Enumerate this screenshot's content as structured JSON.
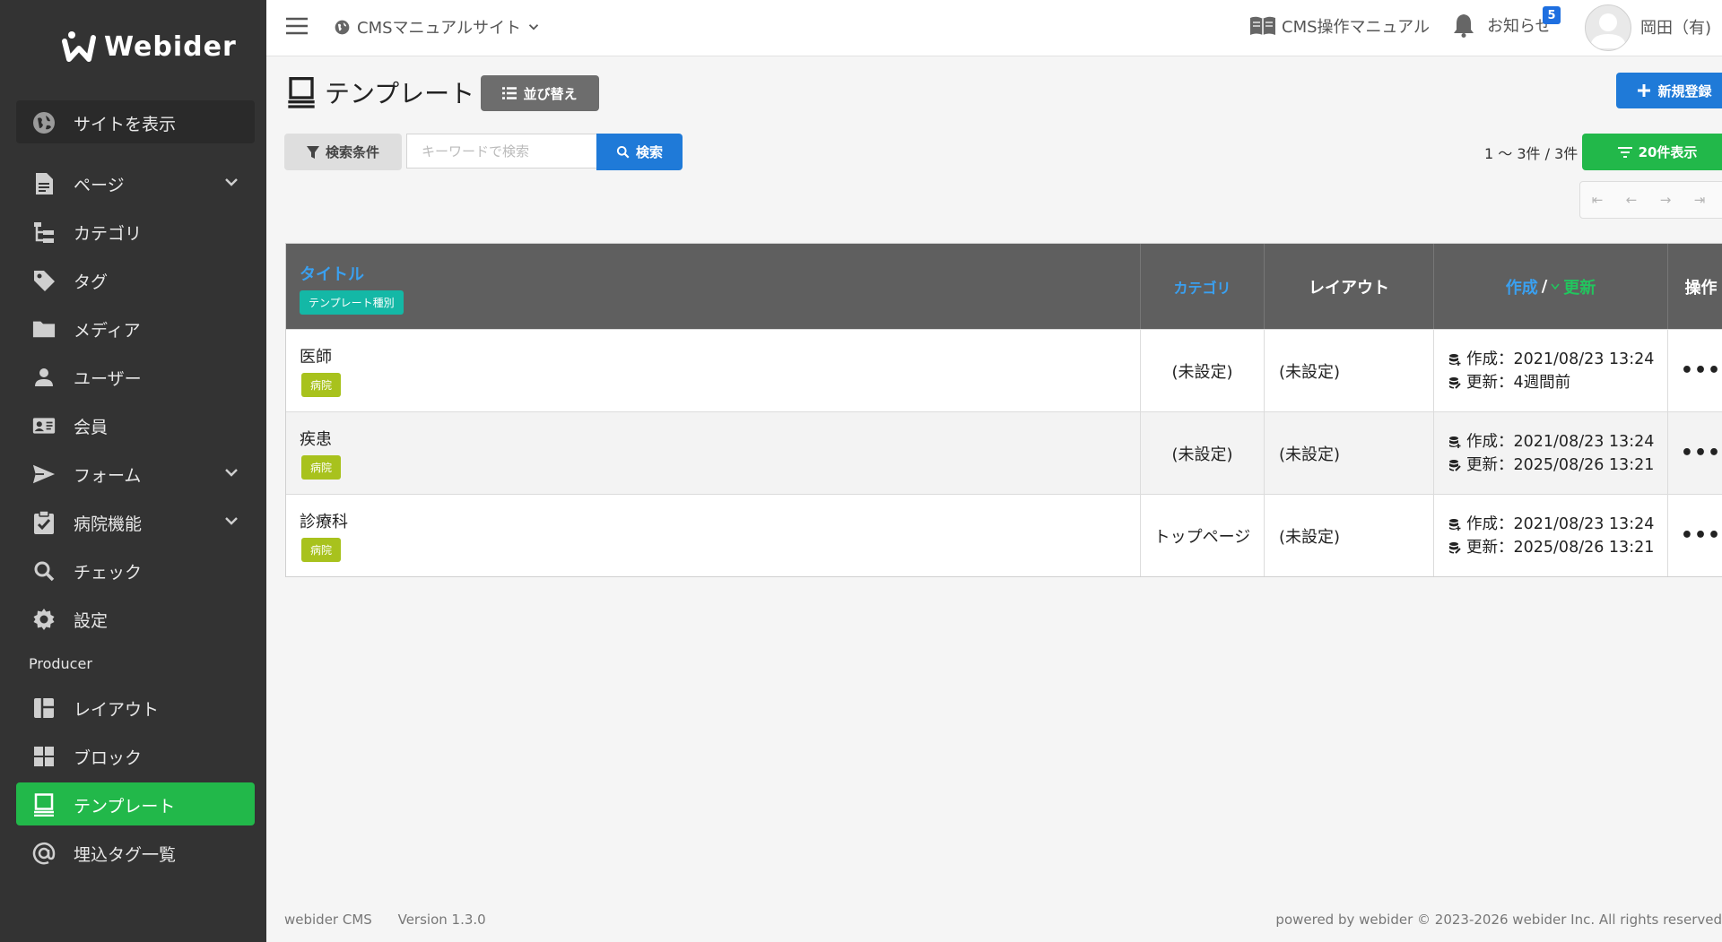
{
  "brand": {
    "name": "Webider"
  },
  "sidebar": {
    "site_link": "サイトを表示",
    "items": [
      {
        "label": "ページ",
        "icon": "page-icon",
        "has_children": true
      },
      {
        "label": "カテゴリ",
        "icon": "category-tree-icon",
        "has_children": false
      },
      {
        "label": "タグ",
        "icon": "tag-icon",
        "has_children": false
      },
      {
        "label": "メディア",
        "icon": "folder-icon",
        "has_children": false
      },
      {
        "label": "ユーザー",
        "icon": "user-icon",
        "has_children": false
      },
      {
        "label": "会員",
        "icon": "member-card-icon",
        "has_children": false
      },
      {
        "label": "フォーム",
        "icon": "send-icon",
        "has_children": true
      },
      {
        "label": "病院機能",
        "icon": "clipboard-check-icon",
        "has_children": true
      },
      {
        "label": "チェック",
        "icon": "search-icon",
        "has_children": false
      },
      {
        "label": "設定",
        "icon": "gear-icon",
        "has_children": false
      }
    ],
    "section_label": "Producer",
    "producer_items": [
      {
        "label": "レイアウト",
        "icon": "layout-icon"
      },
      {
        "label": "ブロック",
        "icon": "block-grid-icon"
      },
      {
        "label": "テンプレート",
        "icon": "template-icon",
        "active": true
      },
      {
        "label": "埋込タグ一覧",
        "icon": "at-sign-icon"
      }
    ]
  },
  "topbar": {
    "site_selector": "CMSマニュアルサイト",
    "manual_link": "CMS操作マニュアル",
    "notice_label": "お知らせ",
    "notice_count": "5",
    "user_name": "岡田（有)"
  },
  "page": {
    "title": "テンプレート",
    "sort_button": "並び替え",
    "new_button": "新規登録",
    "filter_button": "検索条件",
    "search_placeholder": "キーワードで検索",
    "search_button": "検索",
    "count_text": "1 〜 3件 / 3件",
    "per_page_button": "20件表示",
    "pager": [
      "⇤",
      "←",
      "→",
      "⇥"
    ]
  },
  "table": {
    "headers": {
      "title": "タイトル",
      "title_badge": "テンプレート種別",
      "category": "カテゴリ",
      "layout": "レイアウト",
      "created": "作成",
      "separator": "/",
      "updated": "更新",
      "ops": "操作"
    },
    "rows": [
      {
        "title": "医師",
        "tag": "病院",
        "category": "(未設定)",
        "layout": "(未設定)",
        "created": "作成：2021/08/23 13:24",
        "updated": "更新：4週間前",
        "ops": "•••"
      },
      {
        "title": "疾患",
        "tag": "病院",
        "category": "(未設定)",
        "layout": "(未設定)",
        "created": "作成：2021/08/23 13:24",
        "updated": "更新：2025/08/26 13:21",
        "ops": "•••"
      },
      {
        "title": "診療科",
        "tag": "病院",
        "category": "トップページ",
        "layout": "(未設定)",
        "created": "作成：2021/08/23 13:24",
        "updated": "更新：2025/08/26 13:21",
        "ops": "•••"
      }
    ]
  },
  "footer": {
    "product": "webider CMS",
    "version": "Version 1.3.0",
    "copyright": "powered by webider © 2023-2026 webider Inc. All rights reserved"
  },
  "colors": {
    "sidebar_bg": "#333333",
    "active_green": "#22b84a",
    "primary_blue": "#1f7ad8",
    "header_link_blue": "#3aa0f0",
    "header_update_green": "#22c55e",
    "badge_teal": "#14b8a6",
    "tag_lime": "#a8c21d"
  }
}
